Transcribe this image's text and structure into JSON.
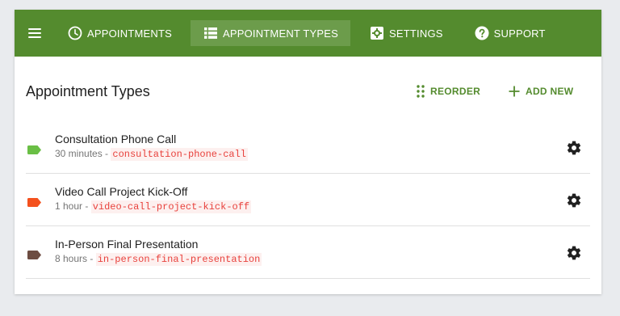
{
  "nav": {
    "menu_icon": "hamburger-icon",
    "items": [
      {
        "label": "APPOINTMENTS",
        "icon": "clock-icon",
        "active": false
      },
      {
        "label": "APPOINTMENT TYPES",
        "icon": "list-icon",
        "active": true
      },
      {
        "label": "SETTINGS",
        "icon": "settings-icon",
        "active": false
      },
      {
        "label": "SUPPORT",
        "icon": "help-icon",
        "active": false
      }
    ]
  },
  "page": {
    "title": "Appointment Types",
    "reorder_label": "REORDER",
    "add_new_label": "ADD NEW"
  },
  "appointment_types": [
    {
      "name": "Consultation Phone Call",
      "duration": "30 minutes",
      "separator": " - ",
      "slug": "consultation-phone-call",
      "color": "#6abf45"
    },
    {
      "name": "Video Call Project Kick-Off",
      "duration": "1 hour",
      "separator": " - ",
      "slug": "video-call-project-kick-off",
      "color": "#f4511e"
    },
    {
      "name": "In-Person Final Presentation",
      "duration": "8 hours",
      "separator": " - ",
      "slug": "in-person-final-presentation",
      "color": "#6d4c41"
    }
  ],
  "colors": {
    "brand": "#548b2e",
    "nav_active": "#6c9c4b",
    "slug_text": "#e8413c",
    "background": "#e9ebee"
  }
}
